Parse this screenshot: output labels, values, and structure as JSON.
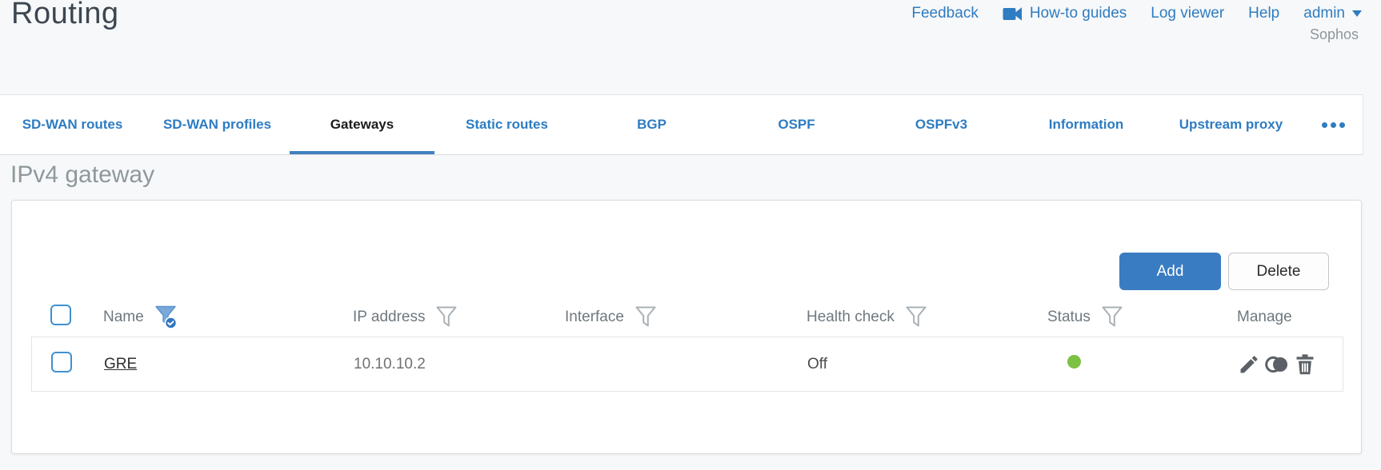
{
  "page": {
    "title": "Routing"
  },
  "header": {
    "links": [
      {
        "label": "Feedback"
      },
      {
        "label": "How-to guides",
        "icon": "video-camera-icon"
      },
      {
        "label": "Log viewer"
      },
      {
        "label": "Help"
      }
    ],
    "user": {
      "name": "admin",
      "menu_icon": "caret-down-icon"
    },
    "brand": "Sophos"
  },
  "tabs": {
    "items": [
      {
        "label": "SD-WAN routes"
      },
      {
        "label": "SD-WAN profiles"
      },
      {
        "label": "Gateways"
      },
      {
        "label": "Static routes"
      },
      {
        "label": "BGP"
      },
      {
        "label": "OSPF"
      },
      {
        "label": "OSPFv3"
      },
      {
        "label": "Information"
      },
      {
        "label": "Upstream proxy"
      }
    ],
    "active_label": "Gateways",
    "overflow_icon": "ellipsis-icon"
  },
  "section": {
    "title": "IPv4 gateway"
  },
  "toolbar": {
    "add_label": "Add",
    "delete_label": "Delete"
  },
  "table": {
    "select_all_checked": false,
    "columns": [
      {
        "label": "Name",
        "filter": "active"
      },
      {
        "label": "IP address",
        "filter": "available"
      },
      {
        "label": "Interface",
        "filter": "available"
      },
      {
        "label": "Health check",
        "filter": "available"
      },
      {
        "label": "Status",
        "filter": "available"
      },
      {
        "label": "Manage",
        "filter": "none"
      }
    ],
    "rows": [
      {
        "checked": false,
        "name": "GRE",
        "ip_address": "10.10.10.2",
        "interface": "",
        "health_check": "Off",
        "status": "up",
        "status_color": "#7cc142",
        "actions": [
          "edit",
          "clone",
          "delete"
        ]
      }
    ]
  },
  "colors": {
    "accent_blue": "#2e7cc2",
    "active_tab_underline": "#4080bf",
    "add_button": "#3a7cc1",
    "status_ok_green": "#7cc142",
    "filter_active_fill": "#79a9d9",
    "filter_badge": "#3076be"
  }
}
